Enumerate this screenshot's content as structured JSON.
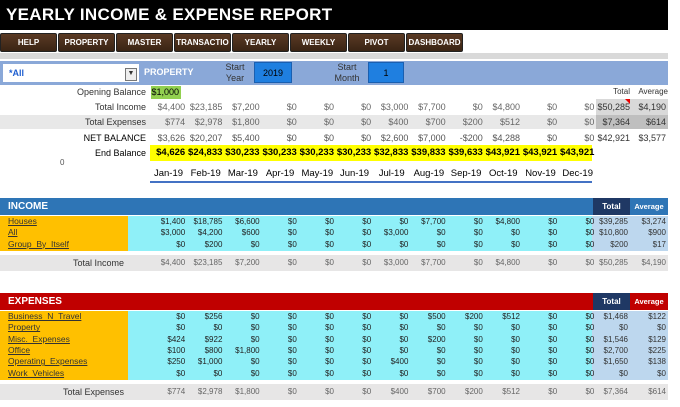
{
  "title": "YEARLY INCOME & EXPENSE REPORT",
  "nav": [
    "HELP",
    "PROPERTY",
    "MASTER",
    "TRANSACTIO",
    "YEARLY",
    "WEEKLY",
    "PIVOT",
    "DASHBOARD"
  ],
  "controls": {
    "filter_value": "*All",
    "property_label": "PROPERTY",
    "start_year_label": "Start Year",
    "start_year": "2019",
    "start_month_label": "Start Month",
    "start_month": "1"
  },
  "summary": {
    "total_label": "Total",
    "average_label": "Average",
    "opening_balance_label": "Opening Balance",
    "opening_balance": "$1,000",
    "total_income_label": "Total Income",
    "total_income": [
      "$4,400",
      "$23,185",
      "$7,200",
      "$0",
      "$0",
      "$0",
      "$3,000",
      "$7,700",
      "$0",
      "$4,800",
      "$0",
      "$0"
    ],
    "total_income_total": "$50,285",
    "total_income_avg": "$4,190",
    "total_expenses_label": "Total Expenses",
    "total_expenses": [
      "$774",
      "$2,978",
      "$1,800",
      "$0",
      "$0",
      "$0",
      "$400",
      "$700",
      "$200",
      "$512",
      "$0",
      "$0"
    ],
    "total_expenses_total": "$7,364",
    "total_expenses_avg": "$614",
    "net_balance_label": "NET BALANCE",
    "net_balance": [
      "$3,626",
      "$20,207",
      "$5,400",
      "$0",
      "$0",
      "$0",
      "$2,600",
      "$7,000",
      "-$200",
      "$4,288",
      "$0",
      "$0"
    ],
    "net_balance_total": "$42,921",
    "net_balance_avg": "$3,577",
    "end_balance_label": "End Balance",
    "end_balance_sub": "0",
    "end_balance": [
      "$4,626",
      "$24,833",
      "$30,233",
      "$30,233",
      "$30,233",
      "$30,233",
      "$32,833",
      "$39,833",
      "$39,633",
      "$43,921",
      "$43,921",
      "$43,921"
    ]
  },
  "months": [
    "Jan-19",
    "Feb-19",
    "Mar-19",
    "Apr-19",
    "May-19",
    "Jun-19",
    "Jul-19",
    "Aug-19",
    "Sep-19",
    "Oct-19",
    "Nov-19",
    "Dec-19"
  ],
  "income": {
    "header": "INCOME",
    "total_label": "Total",
    "average_label": "Average",
    "rows": [
      {
        "label": "Houses",
        "values": [
          "$1,400",
          "$18,785",
          "$6,600",
          "$0",
          "$0",
          "$0",
          "$0",
          "$7,700",
          "$0",
          "$4,800",
          "$0",
          "$0"
        ],
        "total": "$39,285",
        "avg": "$3,274"
      },
      {
        "label": "All",
        "values": [
          "$3,000",
          "$4,200",
          "$600",
          "$0",
          "$0",
          "$0",
          "$3,000",
          "$0",
          "$0",
          "$0",
          "$0",
          "$0"
        ],
        "total": "$10,800",
        "avg": "$900"
      },
      {
        "label": "Group_By_Itself",
        "values": [
          "$0",
          "$200",
          "$0",
          "$0",
          "$0",
          "$0",
          "$0",
          "$0",
          "$0",
          "$0",
          "$0",
          "$0"
        ],
        "total": "$200",
        "avg": "$17"
      }
    ],
    "footer_label": "Total Income",
    "footer_values": [
      "$4,400",
      "$23,185",
      "$7,200",
      "$0",
      "$0",
      "$0",
      "$3,000",
      "$7,700",
      "$0",
      "$4,800",
      "$0",
      "$0"
    ],
    "footer_total": "$50,285",
    "footer_avg": "$4,190"
  },
  "expenses": {
    "header": "EXPENSES",
    "total_label": "Total",
    "average_label": "Average",
    "rows": [
      {
        "label": "Business_N_Travel",
        "values": [
          "$0",
          "$256",
          "$0",
          "$0",
          "$0",
          "$0",
          "$0",
          "$500",
          "$200",
          "$512",
          "$0",
          "$0"
        ],
        "total": "$1,468",
        "avg": "$122"
      },
      {
        "label": "Property",
        "values": [
          "$0",
          "$0",
          "$0",
          "$0",
          "$0",
          "$0",
          "$0",
          "$0",
          "$0",
          "$0",
          "$0",
          "$0"
        ],
        "total": "$0",
        "avg": "$0"
      },
      {
        "label": "Misc._Expenses",
        "values": [
          "$424",
          "$922",
          "$0",
          "$0",
          "$0",
          "$0",
          "$0",
          "$200",
          "$0",
          "$0",
          "$0",
          "$0"
        ],
        "total": "$1,546",
        "avg": "$129"
      },
      {
        "label": "Office",
        "values": [
          "$100",
          "$800",
          "$1,800",
          "$0",
          "$0",
          "$0",
          "$0",
          "$0",
          "$0",
          "$0",
          "$0",
          "$0"
        ],
        "total": "$2,700",
        "avg": "$225"
      },
      {
        "label": "Operating_Expenses",
        "values": [
          "$250",
          "$1,000",
          "$0",
          "$0",
          "$0",
          "$0",
          "$400",
          "$0",
          "$0",
          "$0",
          "$0",
          "$0"
        ],
        "total": "$1,650",
        "avg": "$138"
      },
      {
        "label": "Work_Vehicles",
        "values": [
          "$0",
          "$0",
          "$0",
          "$0",
          "$0",
          "$0",
          "$0",
          "$0",
          "$0",
          "$0",
          "$0",
          "$0"
        ],
        "total": "$0",
        "avg": "$0"
      }
    ],
    "footer_label": "Total Expenses",
    "footer_values": [
      "$774",
      "$2,978",
      "$1,800",
      "$0",
      "$0",
      "$0",
      "$400",
      "$700",
      "$200",
      "$512",
      "$0",
      "$0"
    ],
    "footer_total": "$7,364",
    "footer_avg": "$614"
  }
}
